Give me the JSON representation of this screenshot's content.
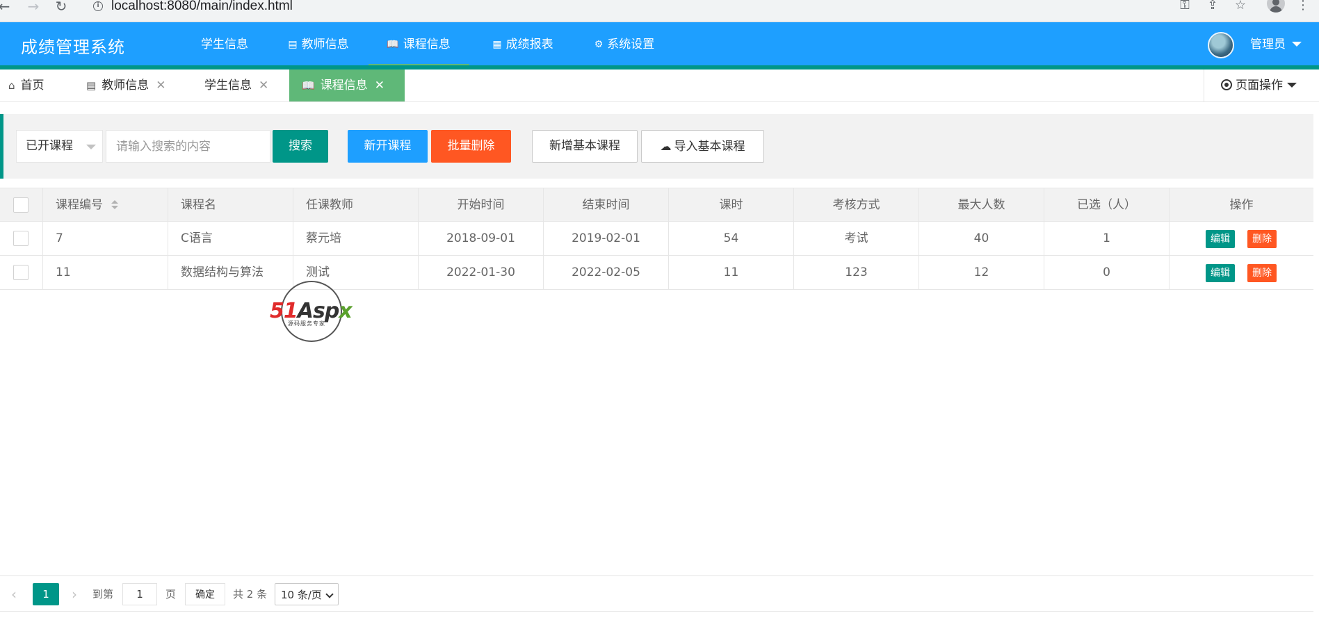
{
  "browser": {
    "url": "localhost:8080/main/index.html",
    "info_glyph": "i"
  },
  "header": {
    "logo": "成绩管理系统",
    "nav": [
      {
        "label": "学生信息"
      },
      {
        "label": "教师信息"
      },
      {
        "label": "课程信息"
      },
      {
        "label": "成绩报表"
      },
      {
        "label": "系统设置"
      }
    ],
    "user": "管理员"
  },
  "tabs": [
    {
      "label": "首页"
    },
    {
      "label": "教师信息"
    },
    {
      "label": "学生信息"
    },
    {
      "label": "课程信息"
    }
  ],
  "page_ops": "页面操作",
  "toolbar": {
    "filter_value": "已开课程",
    "search_placeholder": "请输入搜索的内容",
    "search_btn": "搜索",
    "new_course_btn": "新开课程",
    "batch_delete_btn": "批量删除",
    "add_basic_btn": "新增基本课程",
    "import_basic_btn": "导入基本课程"
  },
  "table": {
    "columns": [
      "课程编号",
      "课程名",
      "任课教师",
      "开始时间",
      "结束时间",
      "课时",
      "考核方式",
      "最大人数",
      "已选（人）",
      "操作"
    ],
    "rows": [
      {
        "id": "7",
        "name": "C语言",
        "teacher": "蔡元培",
        "start": "2018-09-01",
        "end": "2019-02-01",
        "hours": "54",
        "exam": "考试",
        "max": "40",
        "selected": "1"
      },
      {
        "id": "11",
        "name": "数据结构与算法",
        "teacher": "测试",
        "start": "2022-01-30",
        "end": "2022-02-05",
        "hours": "11",
        "exam": "123",
        "max": "12",
        "selected": "0"
      }
    ],
    "edit_label": "编辑",
    "delete_label": "删除"
  },
  "watermark": {
    "part1": "51",
    "part2": "Asp",
    "part3": "x",
    "sub": "源码服务专家"
  },
  "pager": {
    "current": "1",
    "goto_label": "到第",
    "goto_value": "1",
    "page_label": "页",
    "confirm": "确定",
    "total": "共 2 条",
    "per_page": "10 条/页"
  },
  "colors": {
    "header": "#1e9fff",
    "accent_green": "#5fb878",
    "teal": "#009688",
    "orange": "#ff5722"
  }
}
